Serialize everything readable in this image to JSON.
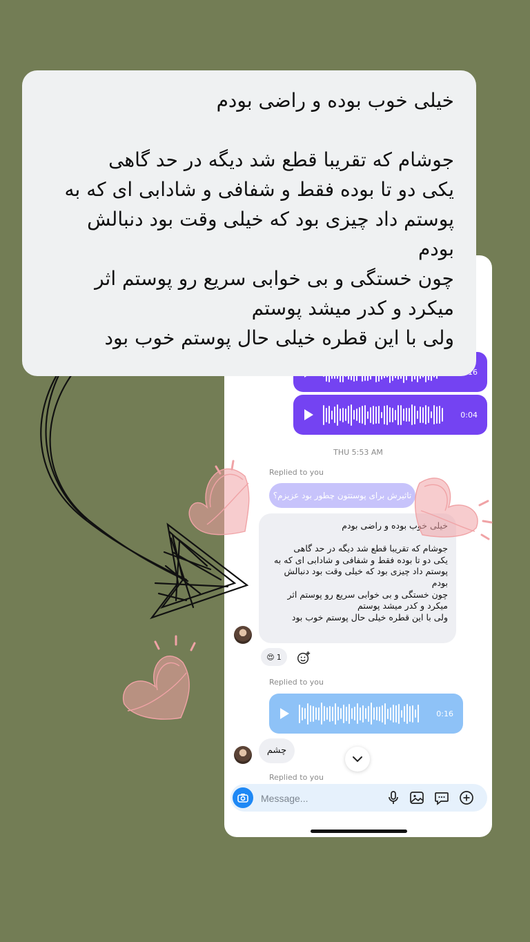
{
  "callout": {
    "text": "خیلی خوب بوده و راضی بودم\n\nجوشام که تقریبا قطع شد دیگه در حد گاهی\nیکی دو تا بوده فقط و شفافی و شادابی ای که به\nپوستم داد چیزی بود که خیلی وقت بود دنبالش\nبودم\nچون خستگی و بی خوابی سریع رو پوستم اثر\nمیکرد و کدر میشد پوستم\nولی با این قطره خیلی حال پوستم خوب بود"
  },
  "chat": {
    "voice_messages": [
      {
        "duration": "0:16",
        "color": "#7443f2"
      },
      {
        "duration": "0:04",
        "color": "#7443f2"
      }
    ],
    "timestamp": "THU 5:53 AM",
    "replied_label_1": "Replied to you",
    "quoted_text": "تاثیرش برای پوستتون چطور بود عزیزم؟",
    "message_text": "خیلی خوب بوده و راضی بودم\n\nجوشام که تقریبا قطع شد دیگه در حد گاهی\nیکی دو تا بوده فقط و شفافی و شادابی ای که به\nپوستم داد چیزی بود که خیلی وقت بود دنبالش\nبودم\nچون خستگی و بی خوابی سریع رو پوستم اثر\nمیکرد و کدر میشد پوستم\nولی با این قطره خیلی حال پوستم خوب بود",
    "reaction_emoji": "😍",
    "reaction_count": "1",
    "replied_label_2": "Replied to you",
    "reply_voice": {
      "duration": "0:16",
      "color": "#8ec2f7"
    },
    "short_message": "چشم",
    "replied_label_3": "Replied to you"
  },
  "composer": {
    "placeholder": "Message..."
  },
  "icons": [
    "camera-icon",
    "microphone-icon",
    "gallery-icon",
    "sticker-icon",
    "plus-icon",
    "chevron-down-icon",
    "add-reaction-icon",
    "play-icon"
  ],
  "colors": {
    "background": "#737d55",
    "accent_purple": "#7443f2",
    "accent_blue": "#8ec2f7",
    "heart_pink": "#f0a3a6"
  }
}
